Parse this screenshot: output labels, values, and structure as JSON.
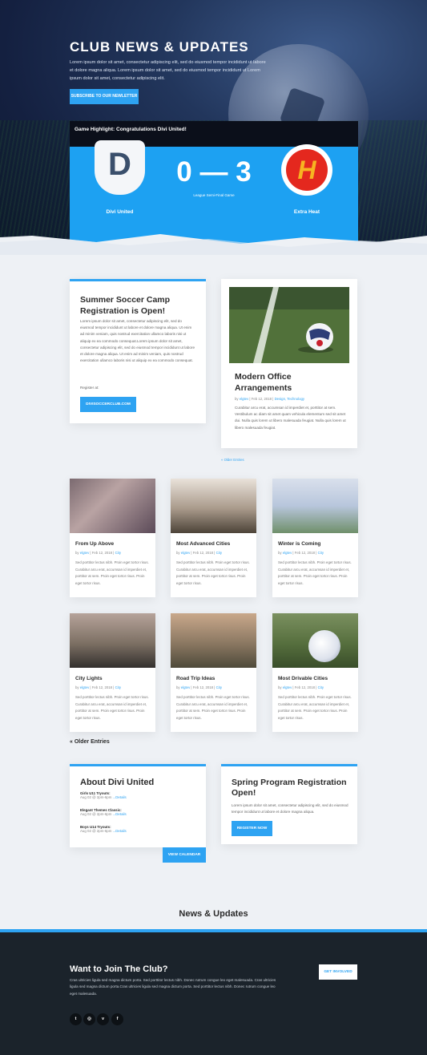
{
  "hero": {
    "title": "CLUB NEWS & UPDATES",
    "text": "Lorem ipsum dolor sit amet, consectetur adipiscing elit, sed do eiusmod tempor incididunt ut labore et dolore magna aliqua. Lorem ipsum dolor sit amet, sed do eiusmod tempor incididunt ut Lorem ipsum dolor sit amet, consectetur adipiscing elit.",
    "subscribe_label": "SUBSCRIBE TO OUR NEWLETTER"
  },
  "game": {
    "highlight": "Game Highlight: Congratulations Divi United!",
    "home_letter": "D",
    "home_team": "Divi United",
    "score": "0 — 3",
    "subtitle": "League Semi-Final Game",
    "away_letter": "H",
    "away_team": "Extra Heat"
  },
  "camp": {
    "title": "Summer Soccer Camp Registration is Open!",
    "body": "Lorem ipsum dolor sit amet, consectetur adipiscing elit, sed do eiusmod tempor incididunt ut labore et dolore magna aliqua. Ut enim ad minim veniam, quis nostrud exercitation ullamco laboris nisi ut aliquip ex ea commodo consequat.Lorem ipsum dolor sit amet, consectetur adipiscing elit, sed do eiusmod tempor incididunt ut labore et dolore magna aliqua. Ut enim ad minim veniam, quis nostrud exercitation ullamco laboris nisi ut aliquip ex ea commodo consequat.",
    "register_text": "Register at:",
    "button_label": "DIVISOCCERCLUB.COM"
  },
  "office": {
    "title": "Modern Office Arrangements",
    "meta_by": "by",
    "author": "elgtev",
    "date": "Feb 12, 2018",
    "categories": "Design, Technology",
    "body": "Curabitur arcu erat, accumsan id imperdiet et, porttitor at sem. Vestibulum ac diam sit amet quam vehicula elementum sed sit amet dui. Nulla quis lorem ut libero malesuada feugiat. Nulla quis lorem ut libero malesuada feugiat."
  },
  "older_small": "« Older Entries",
  "posts": [
    {
      "title": "From Up Above",
      "author": "elgtev",
      "date": "Feb 12, 2018",
      "category": "City",
      "body": "Sed porttitor lectus nibh. Proin eget tortor risus. Curabitur arcu erat, accumsan id imperdiet et, porttitor at sem. Proin eget tortor risus. Proin eget tortor risus."
    },
    {
      "title": "Most Advanced Cities",
      "author": "elgtev",
      "date": "Feb 12, 2018",
      "category": "City",
      "body": "Sed porttitor lectus nibh. Proin eget tortor risus. Curabitur arcu erat, accumsan id imperdiet et, porttitor at sem. Proin eget tortor risus. Proin eget tortor risus."
    },
    {
      "title": "Winter is Coming",
      "author": "elgtev",
      "date": "Feb 12, 2018",
      "category": "City",
      "body": "Sed porttitor lectus nibh. Proin eget tortor risus. Curabitur arcu erat, accumsan id imperdiet et, porttitor at sem. Proin eget tortor risus. Proin eget tortor risus."
    },
    {
      "title": "City Lights",
      "author": "elgtev",
      "date": "Feb 12, 2018",
      "category": "City",
      "body": "Sed porttitor lectus nibh. Proin eget tortor risus. Curabitur arcu erat, accumsan id imperdiet et, porttitor at sem. Proin eget tortor risus. Proin eget tortor risus."
    },
    {
      "title": "Road Trip Ideas",
      "author": "elgtev",
      "date": "Feb 12, 2018",
      "category": "City",
      "body": "Sed porttitor lectus nibh. Proin eget tortor risus. Curabitur arcu erat, accumsan id imperdiet et, porttitor at sem. Proin eget tortor risus. Proin eget tortor risus."
    },
    {
      "title": "Most Drivable Cities",
      "author": "elgtev",
      "date": "Feb 12, 2018",
      "category": "City",
      "body": "Sed porttitor lectus nibh. Proin eget tortor risus. Curabitur arcu erat, accumsan id imperdiet et, porttitor at sem. Proin eget tortor risus. Proin eget tortor risus."
    }
  ],
  "post_meta_by": "by",
  "older_big": "« Older Entries",
  "about": {
    "title": "About Divi United",
    "events": [
      {
        "name": "Girls U11 Tryouts:",
        "date": "Aug 02 @ 2pm-6pm",
        "link": "...Details"
      },
      {
        "name": "Elegant Themes Classic:",
        "date": "Aug 02 @ 2pm-6pm",
        "link": "...Details"
      },
      {
        "name": "Boys U14 Tryouts:",
        "date": "Aug 02 @ 2pm-6pm",
        "link": "...Details"
      }
    ],
    "calendar_label": "VIEW CALENDAR"
  },
  "spring": {
    "title": "Spring Program Registration Open!",
    "body": "Lorem ipsum dolor sit amet, consectetur adipiscing elit, sed do eiusmod tempor incididunt ut labore et dolore magna aliqua.",
    "button_label": "REGISTER NOW"
  },
  "news_title": "News & Updates",
  "footer": {
    "title": "Want to Join The Club?",
    "body": "Cras ultricies ligula sed magna dictum porta. Sed porttitor lectus nibh. Donec rutrum congue leo eget malesuada. Cras ultricies ligula sed magna dictum porta.Cras ultricies ligula sed magna dictum porta. Sed porttitor lectus nibh. Donec rutrum congue leo eget malesuada.",
    "button_label": "GET INVOLVED",
    "social": [
      {
        "icon": "twitter-icon",
        "glyph": "t"
      },
      {
        "icon": "instagram-icon",
        "glyph": "◎"
      },
      {
        "icon": "vimeo-icon",
        "glyph": "v"
      },
      {
        "icon": "facebook-icon",
        "glyph": "f"
      }
    ]
  },
  "colors": {
    "accent": "#2ea3f2",
    "game_blue": "#1da1f2",
    "footer": "#1b232b",
    "background": "#eef1f5"
  }
}
